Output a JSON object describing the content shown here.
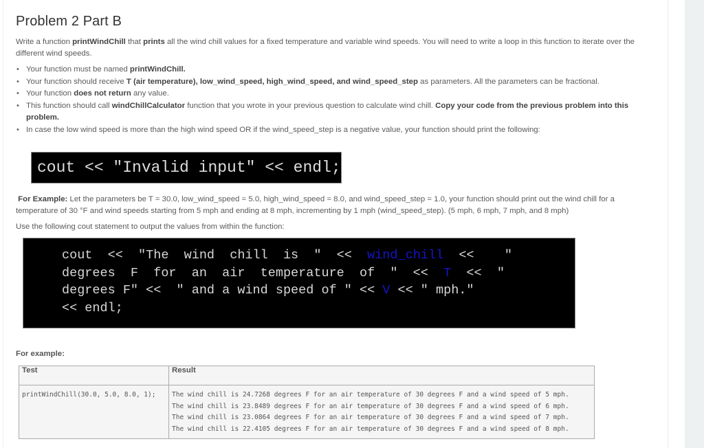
{
  "question": {
    "title": "Problem 2 Part B",
    "intro": {
      "t1": "Write a function ",
      "b1": "printWindChill",
      "t2": " that ",
      "b2": "prints",
      "t3": " all the wind chill values for a fixed temperature and variable wind speeds. You will need to write a loop in this function to iterate over the different wind speeds."
    },
    "requirements": [
      {
        "t1": "Your function must be named ",
        "b1": "printWindChill.",
        "t2": "",
        "b2": "",
        "t3": ""
      },
      {
        "t1": "Your function should receive ",
        "b1": "T (air temperature), low_wind_speed, high_wind_speed, and wind_speed_step",
        "t2": " as parameters. All the parameters can be fractional.",
        "b2": "",
        "t3": ""
      },
      {
        "t1": "Your function ",
        "b1": "does not return",
        "t2": " any value.",
        "b2": "",
        "t3": ""
      },
      {
        "t1": "This function should call ",
        "b1": "windChillCalculator",
        "t2": " function that you wrote in your previous question to calculate wind chill. ",
        "b2": "Copy your code from the previous problem into this problem.",
        "t3": ""
      },
      {
        "t1": "In case the low wind speed is more than the high wind speed OR if the wind_speed_step is a negative value, your function should print the following:",
        "b1": "",
        "t2": "",
        "b2": "",
        "t3": ""
      }
    ],
    "invalid_code": "cout << \"Invalid input\" << endl;",
    "example": {
      "label": "For Example:",
      "text": " Let the parameters be T = 30.0, low_wind_speed = 5.0, high_wind_speed = 8.0, and wind_speed_step = 1.0, your function should print out the wind chill for a temperature of 30 °F and wind speeds starting from 5 mph and ending at 8 mph, incrementing by 1 mph (wind_speed_step). (5 mph, 6 mph, 7 mph, and 8 mph)"
    },
    "use_statement": "Use the following cout statement to output the values from within the function:",
    "cout_code": {
      "l1a": "cout  <<  \"The  wind  chill  is  \"  <<  ",
      "l1var": "wind_chill",
      "l1b": "  <<    \"",
      "l2a": "degrees  F  for  an  air  temperature  of  \"  <<  ",
      "l2var": "T",
      "l2b": "  <<  \"",
      "l3a": "degrees F\" <<  \" and a wind speed of \" << ",
      "l3var": "V",
      "l3b": " << \" mph.\"",
      "l4": "<< endl;"
    },
    "for_example_label": "For example:",
    "table": {
      "headers": [
        "Test",
        "Result"
      ],
      "rows": [
        {
          "test": "printWindChill(30.0, 5.0, 8.0, 1);",
          "result": [
            "The wind chill is 24.7268 degrees F for an air temperature of 30 degrees F and a wind speed of 5 mph.",
            "The wind chill is 23.8489 degrees F for an air temperature of 30 degrees F and a wind speed of 6 mph.",
            "The wind chill is 23.0864 degrees F for an air temperature of 30 degrees F and a wind speed of 7 mph.",
            "The wind chill is 22.4105 degrees F for an air temperature of 30 degrees F and a wind speed of 8 mph."
          ]
        }
      ]
    }
  }
}
